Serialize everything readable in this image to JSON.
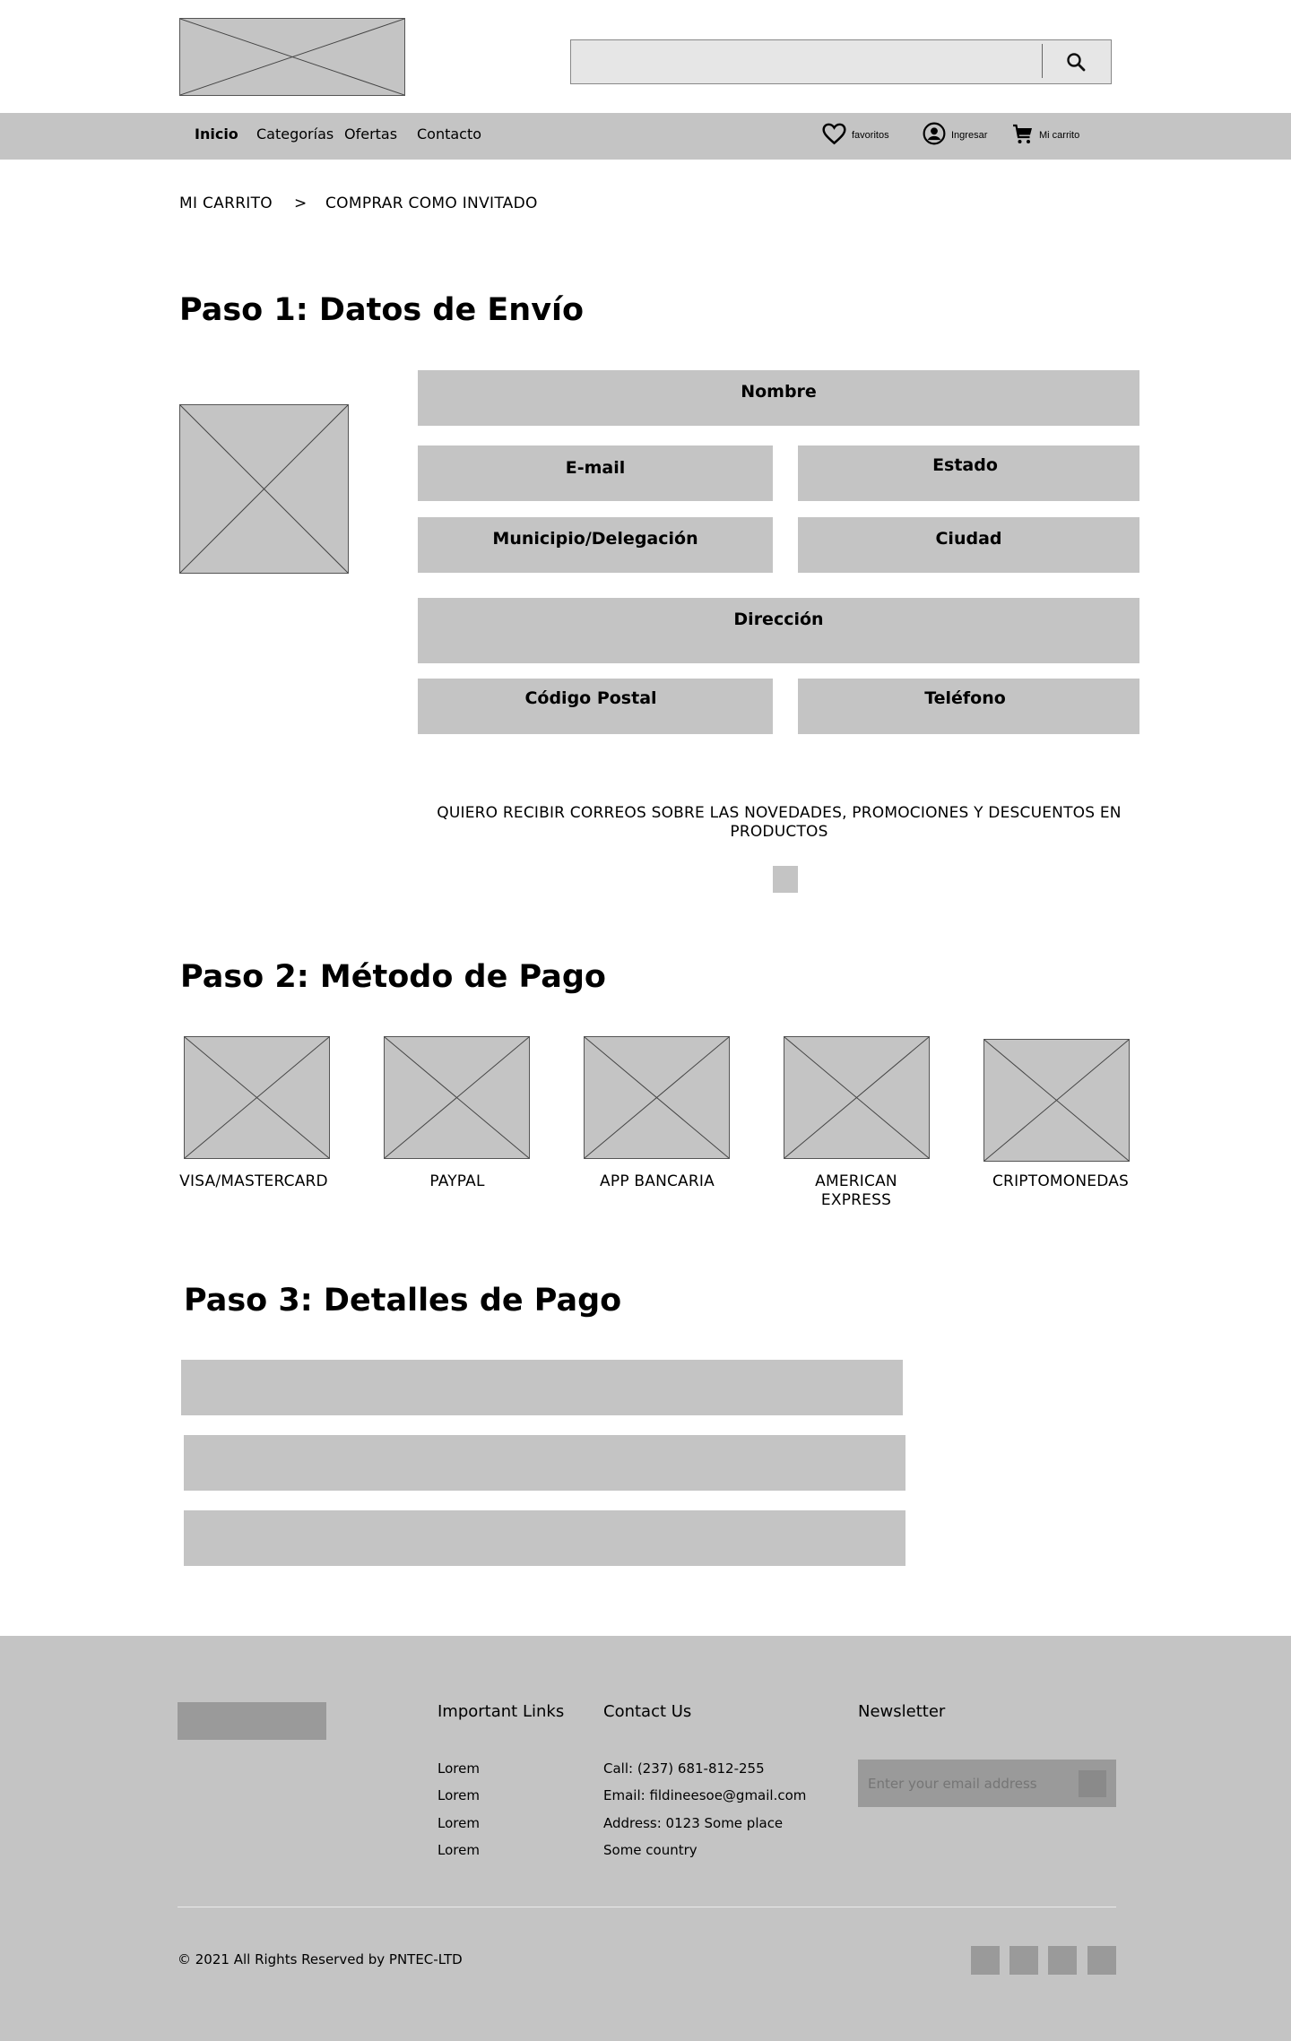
{
  "header": {
    "logo_icon": "image-placeholder-icon",
    "search": {
      "value": "",
      "button_icon": "search-icon"
    }
  },
  "nav": {
    "links": [
      "Inicio",
      "Categorías",
      "Ofertas",
      "Contacto"
    ],
    "favorites": {
      "icon": "heart-icon",
      "label": "favoritos"
    },
    "login": {
      "icon": "user-circle-icon",
      "label": "Ingresar"
    },
    "cart": {
      "icon": "cart-icon",
      "label": "Mi carrito"
    }
  },
  "breadcrumb": {
    "items": [
      "MI CARRITO",
      "COMPRAR COMO INVITADO"
    ],
    "separator": ">"
  },
  "step1": {
    "title": "Paso 1: Datos de Envío",
    "fields": {
      "nombre": "Nombre",
      "email": "E-mail",
      "estado": "Estado",
      "municipio": "Municipio/Delegación",
      "ciudad": "Ciudad",
      "direccion": "Dirección",
      "cp": "Código Postal",
      "telefono": "Teléfono"
    },
    "newsletter_optin": "QUIERO RECIBIR CORREOS SOBRE LAS NOVEDADES, PROMOCIONES Y DESCUENTOS EN PRODUCTOS"
  },
  "step2": {
    "title": "Paso 2: Método de Pago",
    "methods": [
      "VISA/MASTERCARD",
      "PAYPAL",
      "APP BANCARIA",
      "AMERICAN EXPRESS",
      "CRIPTOMONEDAS"
    ]
  },
  "step3": {
    "title": "Paso 3: Detalles de Pago"
  },
  "footer": {
    "links_title": "Important Links",
    "links": [
      "Lorem",
      "Lorem",
      "Lorem",
      "Lorem"
    ],
    "contact_title": "Contact Us",
    "contact": [
      "Call: (237) 681-812-255",
      "Email: fildineesoe@gmail.com",
      "Address: 0123 Some place",
      "Some country"
    ],
    "newsletter_title": "Newsletter",
    "newsletter_placeholder": "Enter your email address",
    "copyright": "© 2021 All Rights Reserved by PNTEC-LTD"
  },
  "colors": {
    "placeholder_gray": "#c4c4c4",
    "dark_gray": "#9a9a9a",
    "search_bg": "#e6e6e6"
  }
}
